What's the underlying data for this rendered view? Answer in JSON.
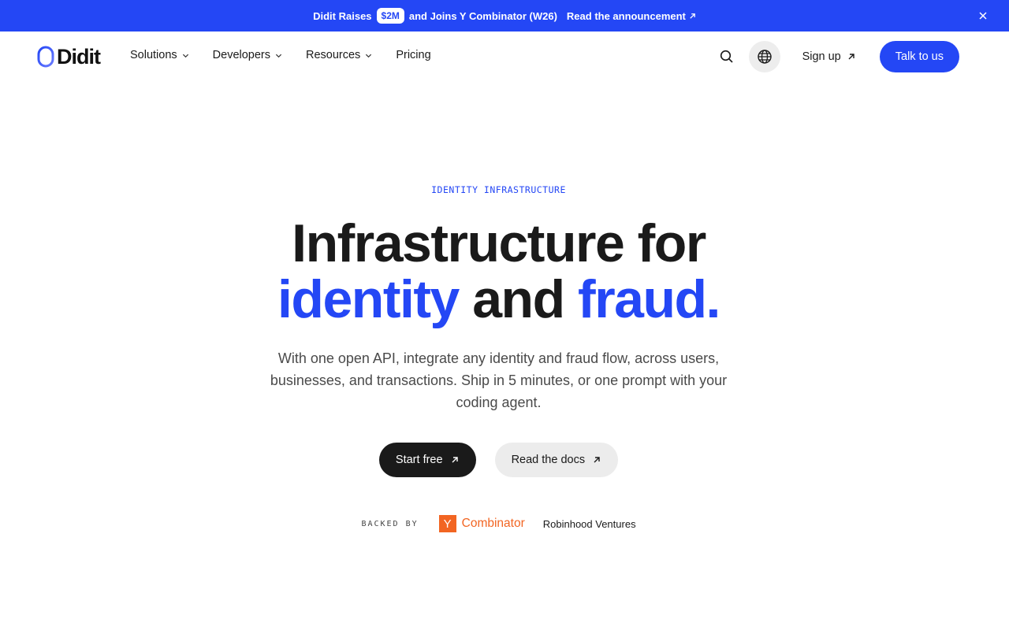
{
  "announcement": {
    "prefix": "Didit Raises",
    "badge": "$2M",
    "suffix": "and Joins Y Combinator (W26)",
    "link": "Read the announcement"
  },
  "nav": {
    "logo_text": "Didit",
    "menu": [
      {
        "label": "Solutions",
        "has_dropdown": true
      },
      {
        "label": "Developers",
        "has_dropdown": true
      },
      {
        "label": "Resources",
        "has_dropdown": true
      },
      {
        "label": "Pricing",
        "has_dropdown": false
      }
    ],
    "signup": "Sign up",
    "talk": "Talk to us"
  },
  "hero": {
    "eyebrow": "IDENTITY INFRASTRUCTURE",
    "headline_line1": "Infrastructure for",
    "headline_word_identity": "identity",
    "headline_and": "and",
    "headline_word_fraud": "fraud.",
    "subtitle": "With one open API, integrate any identity and fraud flow, across users, businesses, and transactions. Ship in 5 minutes, or one prompt with your coding agent.",
    "primary_cta": "Start free",
    "secondary_cta": "Read the docs"
  },
  "backed": {
    "label": "BACKED BY",
    "yc_letter": "Y",
    "yc_name": "Combinator",
    "other": "Robinhood Ventures"
  },
  "colors": {
    "accent": "#2447f5",
    "dark": "#1a1a1a",
    "yc_orange": "#f26522"
  },
  "icons": [
    "arrow-up-right-icon",
    "close-icon",
    "chevron-down-icon",
    "search-icon",
    "globe-icon",
    "didit-logo-icon"
  ]
}
